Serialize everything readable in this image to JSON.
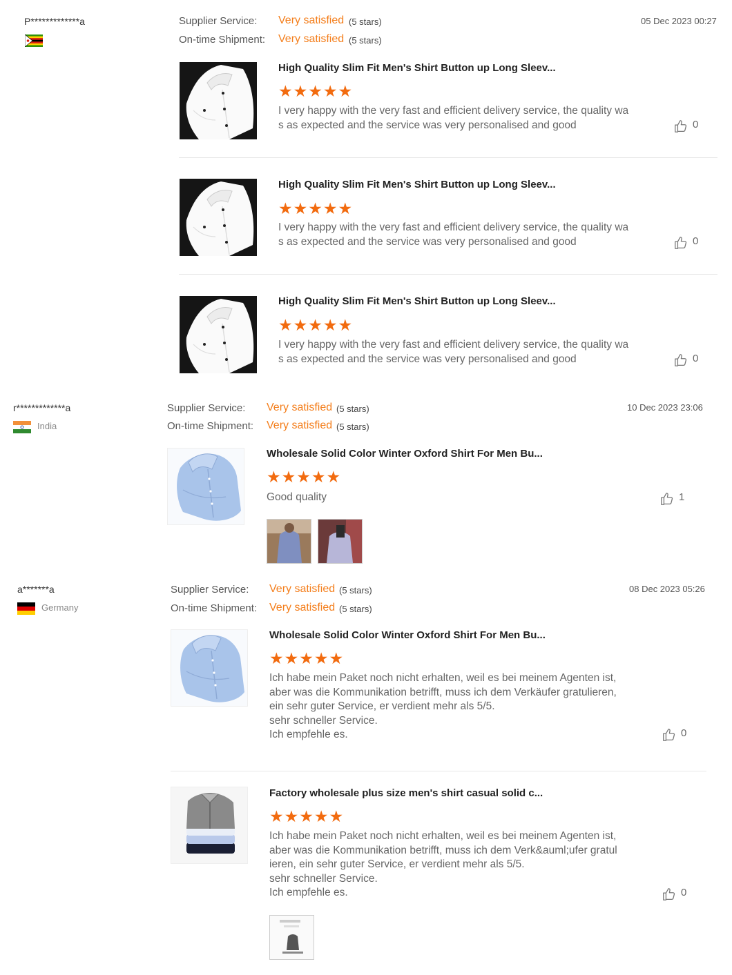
{
  "colors": {
    "accent": "#f47e1b",
    "star": "#f26b0f"
  },
  "reviews": [
    {
      "user": "P*************a",
      "country": "",
      "flag": "zimbabwe-flag",
      "supplier_label": "Supplier Service:",
      "supplier_value": "Very satisfied",
      "supplier_stars": "(5 stars)",
      "shipment_label": "On-time Shipment:",
      "shipment_value": "Very satisfied",
      "shipment_stars": "(5 stars)",
      "date": "05 Dec 2023 00:27",
      "items": [
        {
          "title": "High Quality Slim Fit Men's Shirt Button up Long Sleev...",
          "rating": 5,
          "text": "I very happy with the very fast and efficient delivery service, the quality wa\ns as expected and the service was very personalised and good",
          "likes": "0",
          "thumb": "white-shirt"
        },
        {
          "title": "High Quality Slim Fit Men's Shirt Button up Long Sleev...",
          "rating": 5,
          "text": "I very happy with the very fast and efficient delivery service, the quality wa\ns as expected and the service was very personalised and good",
          "likes": "0",
          "thumb": "white-shirt"
        },
        {
          "title": "High Quality Slim Fit Men's Shirt Button up Long Sleev...",
          "rating": 5,
          "text": "I very happy with the very fast and efficient delivery service, the quality wa\ns as expected and the service was very personalised and good",
          "likes": "0",
          "thumb": "white-shirt"
        }
      ]
    },
    {
      "user": "r*************a",
      "country": "India",
      "flag": "india-flag",
      "supplier_label": "Supplier Service:",
      "supplier_value": "Very satisfied",
      "supplier_stars": "(5 stars)",
      "shipment_label": "On-time Shipment:",
      "shipment_value": "Very satisfied",
      "shipment_stars": "(5 stars)",
      "date": "10 Dec 2023 23:06",
      "items": [
        {
          "title": "Wholesale Solid Color Winter Oxford Shirt For Men Bu...",
          "rating": 5,
          "text": "Good quality",
          "likes": "1",
          "thumb": "blue-shirt"
        }
      ]
    },
    {
      "user": "a*******a",
      "country": "Germany",
      "flag": "germany-flag",
      "supplier_label": "Supplier Service:",
      "supplier_value": "Very satisfied",
      "supplier_stars": "(5 stars)",
      "shipment_label": "On-time Shipment:",
      "shipment_value": "Very satisfied",
      "shipment_stars": "(5 stars)",
      "date": "08 Dec 2023 05:26",
      "items": [
        {
          "title": "Wholesale Solid Color Winter Oxford Shirt For Men Bu...",
          "rating": 5,
          "text": "Ich habe mein Paket noch nicht erhalten, weil es bei meinem Agenten ist,\naber was die Kommunikation betrifft, muss ich dem Verkäufer gratulieren,\nein sehr guter Service, er verdient mehr als 5/5.\nsehr schneller Service.\nIch empfehle es.",
          "likes": "0",
          "thumb": "blue-shirt"
        },
        {
          "title": "Factory wholesale plus size men's shirt casual solid c...",
          "rating": 5,
          "text": "Ich habe mein Paket noch nicht erhalten, weil es bei meinem Agenten ist,\naber was die Kommunikation betrifft, muss ich dem Verk&auml;ufer gratul\nieren, ein sehr guter Service, er verdient mehr als 5/5.\nsehr schneller Service.\nIch empfehle es.",
          "likes": "0",
          "thumb": "stacked-shirts"
        }
      ]
    }
  ]
}
